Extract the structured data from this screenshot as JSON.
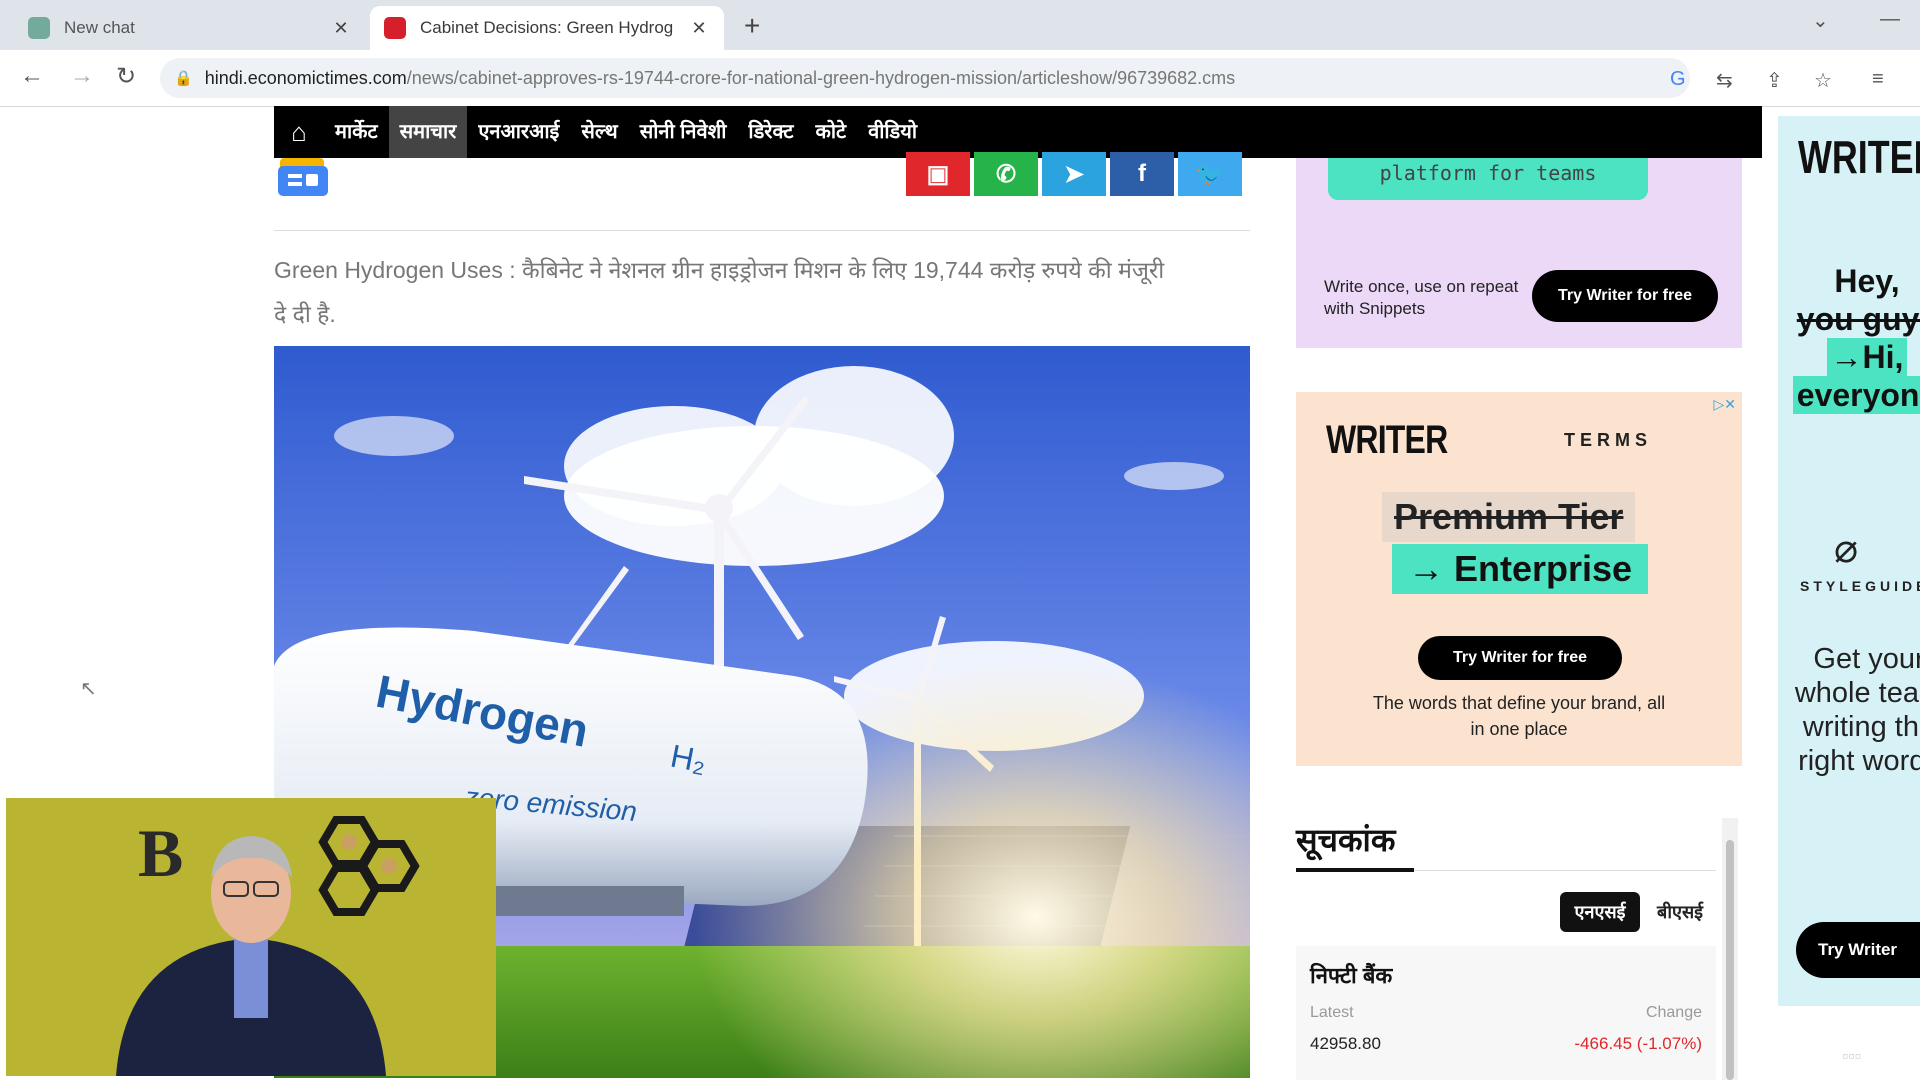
{
  "browser": {
    "tabs": [
      {
        "title": "New chat",
        "active": false
      },
      {
        "title": "Cabinet Decisions: Green Hydrog",
        "active": true
      }
    ],
    "url_host": "hindi.economictimes.com",
    "url_path": "/news/cabinet-approves-rs-19744-crore-for-national-green-hydrogen-mission/articleshow/96739682.cms"
  },
  "site_nav": {
    "items": [
      "मार्केट",
      "समाचार",
      "एनआरआई",
      "सेल्थ",
      "सोनी निवेशी",
      "डिरेक्ट",
      "कोटे",
      "वीडियो"
    ],
    "active_index": 1
  },
  "article": {
    "summary": "Green Hydrogen Uses : कैबिनेट ने नेशनल ग्रीन हाइड्रोजन मिशन के लिए 19,744 करोड़ रुपये की मंजूरी दे दी है.",
    "image_tank_text": "Hydrogen",
    "image_h2": "H₂",
    "image_emission": "zero emission"
  },
  "ads": {
    "ad1": {
      "banner": "platform for teams",
      "text": "Write once, use on repeat with Snippets",
      "button": "Try Writer for free"
    },
    "ad2": {
      "logo": "WRITER",
      "terms": "TERMS",
      "premium": "Premium Tier",
      "enterprise": "→ Enterprise",
      "button": "Try Writer for free",
      "tagline": "The words that define your brand, all in one place"
    },
    "ad3": {
      "logo": "WRITER",
      "line1": "Hey,",
      "line2": "you guys",
      "line3": "→Hi,",
      "line4": "everyone",
      "brand": "STYLEGUIDE",
      "body": "Get your whole team writing the right words",
      "button": "Try Writer"
    }
  },
  "indices": {
    "title": "सूचकांक",
    "tabs": [
      "एनएसई",
      "बीएसई"
    ],
    "active_tab": 0,
    "item": {
      "name": "निफ्टी बैंक",
      "latest_label": "Latest",
      "change_label": "Change",
      "latest": "42958.80",
      "change": "-466.45 (-1.07%)"
    }
  },
  "colors": {
    "nav_bg": "#000000",
    "accent_green": "#4be3c2",
    "negative": "#e0272b"
  }
}
